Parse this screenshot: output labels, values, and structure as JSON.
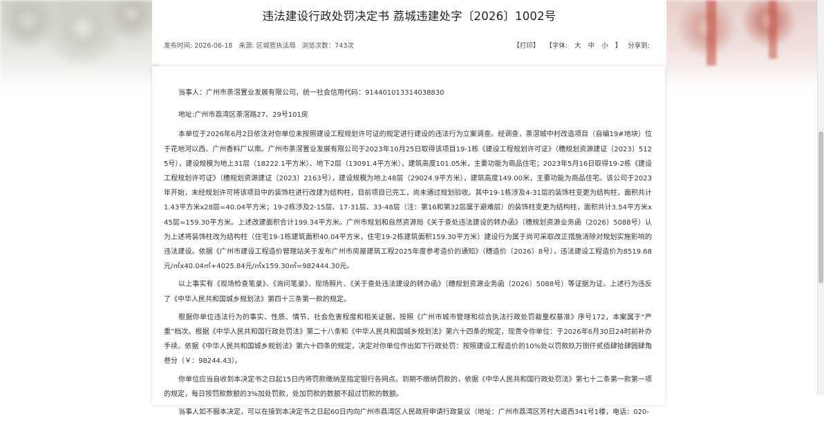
{
  "document": {
    "title": "违法建设行政处罚决定书 荔城违建处字〔2026〕1002号",
    "meta": {
      "publish_time": "发布时间: 2026-06-18",
      "source": "来源: 区城管执法局",
      "views": "浏览次数：743次"
    },
    "tools": {
      "print": "【打印】",
      "font_label": "【字体:",
      "font_large": "大",
      "font_medium": "中",
      "font_small": "小",
      "font_close": "】",
      "share": "分享到:"
    },
    "paragraphs": [
      "当事人：广州市荼滘置业发展有限公司，统一社会信用代码：914401013314038830",
      "地址:广州市荔湾区荼滘路27、29号101房",
      "本单位于2026年6月2日依法对你单位未按照建设工程规划许可证的规定进行建设的违法行为立案调查。经调查，荼滘城中村改造项目（自编19#地块）位于花地河以西、广州香料厂以南。广州市荼滘置业发展有限公司于2023年10月25日取得该项目19-1栋《建设工程规划许可证》（穗规划资源建证〔2023〕5125号），建设规模为地上31层（18222.1平方米）、地下2层（13091.4平方米），建筑高度101.05米，主要功能为商品住宅；2023年5月16日取得19-2栋《建设工程规划许可证》（穗规划资源建证〔2023〕2163号），建设规模为地上48层（29024.9平方米），建筑高度149.00米，主要功能为商品住宅。该公司于2023年开始，未经规划许可将该项目中的装饰柱进行改建为结构柱，目前项目已完工，尚未通过规划验收。其中19-1栋涉及4-31层的装饰柱变更为结构柱，面积共计1.43平方米x28层=40.04平方米；19-2栋涉及2-15层、17-31层、33-48层（注：第16和第32层属于避难层）的装饰柱变更为结构柱，面积共计3.54平方米x45层=159.30平方米。上述改建面积合计199.34平方米。广州市规划和自然资源局《关于查处违法建设的转办函》（穗规划资源业务函〔2026〕5088号）认为上述将装饰柱改为结构柱（住宅19-1栋建筑面积40.04平方米，住宅19-2栋建筑面积159.30平方米）建设行为属于尚可采取改正措施消除对规划实施影响的违法建设。依据《广州市建设工程造价管理站关于发布广州市房屋建筑工程2025年度参考造价的通知》（穗造价〔2026〕8号），违法建设工程造价为8519.68元/㎡x40.04㎡+4025.84元/㎡x159.30㎡=982444.30元。",
      "以上事实有《现场检查笔录》、《询问笔录》、现场照片、《关于查处违法建设的转办函》（穗规划资源业务函〔2026〕5088号）等证据为证。上述行为违反了《中华人民共和国城乡规划法》第四十三条第一款的规定。",
      "根据你单位违法行为的事实、性质、情节、社会危害程度和相关证据，按照《广州市城市管理和综合执法行政处罚裁量权基准》序号172，本案属于“严重”档次。根据《中华人民共和国行政处罚法》第二十八条和《中华人民共和国城乡规划法》第六十四条的规定，现责令你单位：于2026年6月30日24时前补办手续。依据《中华人民共和国城乡规划法》第六十四条的规定，决定对你单位作出如下行政处罚：按照建设工程造价的10%处以罚款玖万捌仟贰佰肆拾肆圆肆角叁分（￥：98244.43）。",
      "你单位应当自收到本决定书之日起15日内将罚款缴纳至指定银行各网点。到期不缴纳罚款的，依据《中华人民共和国行政处罚法》第七十二条第一款第一项的规定，每日按罚款数额的3%加处罚款，处加罚款的数额不超过罚款的数额。",
      "当事人如不服本决定，可以在接到本决定书之日起60日内向广州市荔湾区人民政府申请行政复议（地址：广州市荔湾区芳村大道西341号1楼，电话：020-"
    ]
  }
}
